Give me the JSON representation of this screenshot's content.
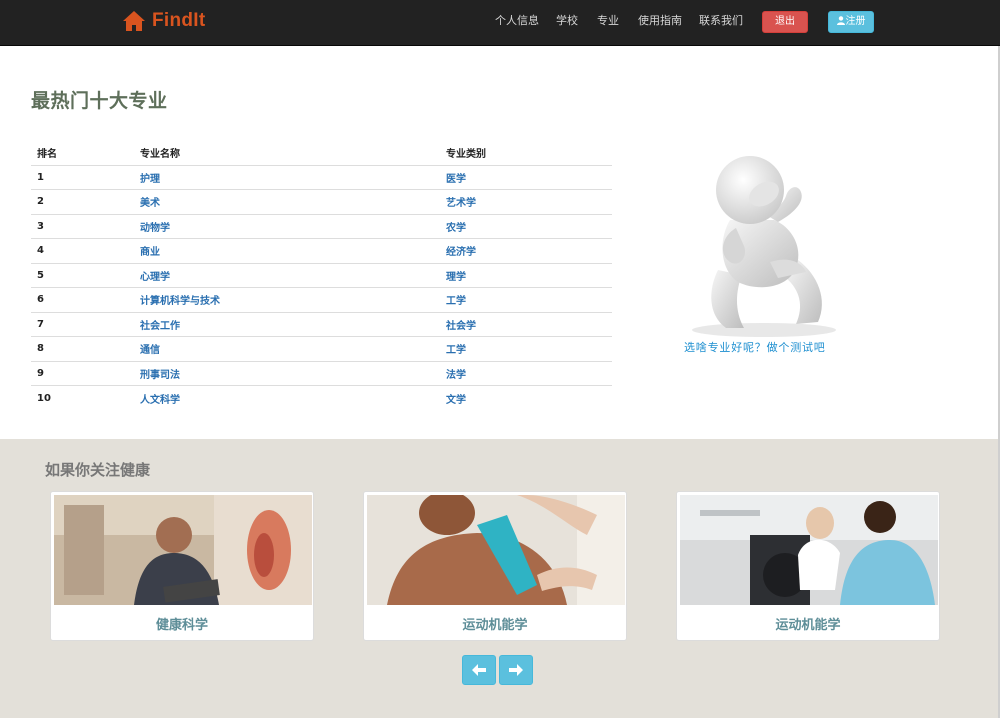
{
  "navbar": {
    "brand": "FindIt",
    "links": [
      "个人信息",
      "学校",
      "专业",
      "使用指南",
      "联系我们"
    ],
    "logout_label": "退出",
    "register_label": "注册"
  },
  "main": {
    "title": "最热门十大专业",
    "table": {
      "headers": [
        "排名",
        "专业名称",
        "专业类别"
      ],
      "rows": [
        [
          "1",
          "护理",
          "医学"
        ],
        [
          "2",
          "美术",
          "艺术学"
        ],
        [
          "3",
          "动物学",
          "农学"
        ],
        [
          "4",
          "商业",
          "经济学"
        ],
        [
          "5",
          "心理学",
          "理学"
        ],
        [
          "6",
          "计算机科学与技术",
          "工学"
        ],
        [
          "7",
          "社会工作",
          "社会学"
        ],
        [
          "8",
          "通信",
          "工学"
        ],
        [
          "9",
          "刑事司法",
          "法学"
        ],
        [
          "10",
          "人文科学",
          "文学"
        ]
      ]
    },
    "promo_caption": "选啥专业好呢？做个测试吧"
  },
  "health": {
    "title": "如果你关注健康",
    "cards": [
      {
        "label": "健康科学"
      },
      {
        "label": "运动机能学"
      },
      {
        "label": "运动机能学"
      }
    ]
  },
  "colors": {
    "navbar_bg": "#222222",
    "brand": "#d9541f",
    "logout": "#d9534f",
    "register": "#5bc0de",
    "link": "#2a6fb0",
    "health_bg": "#e3e0d9"
  }
}
